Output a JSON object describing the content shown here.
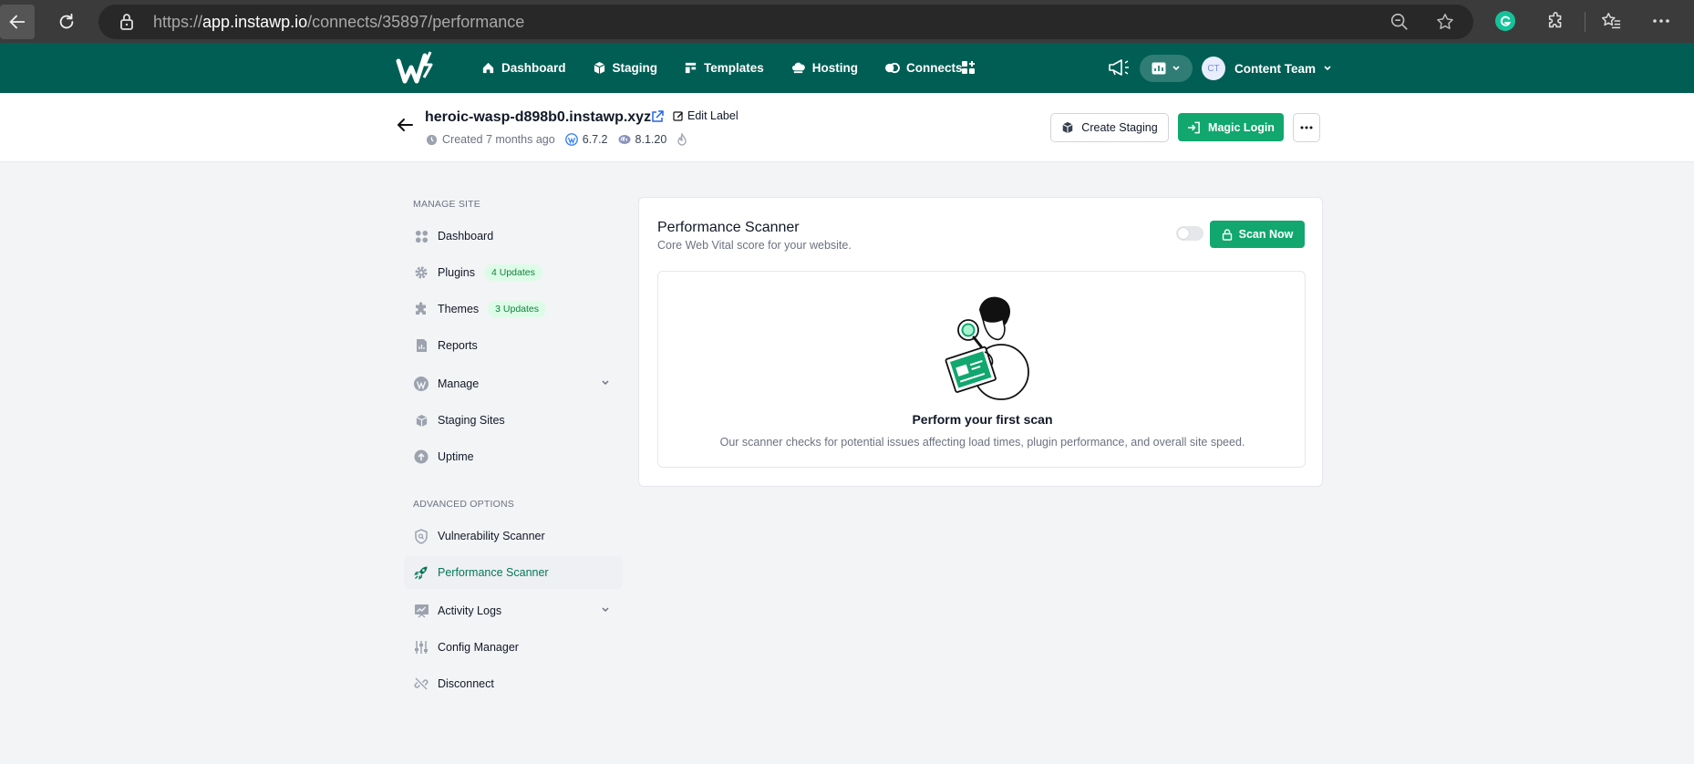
{
  "browser": {
    "url_scheme": "https://",
    "url_host": "app.instawp.io",
    "url_path": "/connects/35897/performance"
  },
  "header": {
    "nav": [
      {
        "label": "Dashboard",
        "icon": "home-icon"
      },
      {
        "label": "Staging",
        "icon": "cube-icon"
      },
      {
        "label": "Templates",
        "icon": "template-icon"
      },
      {
        "label": "Hosting",
        "icon": "cloud-icon"
      },
      {
        "label": "Connects",
        "icon": "connects-icon"
      }
    ],
    "user": {
      "initials": "CT",
      "name": "Content Team"
    },
    "brand_color": "#005e54"
  },
  "site": {
    "name": "heroic-wasp-d898b0.instawp.xyz",
    "edit_label": "Edit Label",
    "created": "Created 7 months ago",
    "wp_version": "6.7.2",
    "php_version": "8.1.20",
    "create_staging": "Create Staging",
    "magic_login": "Magic Login"
  },
  "sidebar": {
    "manage_title": "MANAGE SITE",
    "manage_items": [
      {
        "label": "Dashboard",
        "icon": "grid-icon"
      },
      {
        "label": "Plugins",
        "icon": "gear-icon",
        "badge": "4 Updates"
      },
      {
        "label": "Themes",
        "icon": "puzzle-icon",
        "badge": "3 Updates"
      },
      {
        "label": "Reports",
        "icon": "report-icon"
      },
      {
        "label": "Manage",
        "icon": "wordpress-icon"
      },
      {
        "label": "Staging Sites",
        "icon": "cube-icon"
      },
      {
        "label": "Uptime",
        "icon": "uptime-icon"
      }
    ],
    "advanced_title": "ADVANCED OPTIONS",
    "advanced_items": [
      {
        "label": "Vulnerability Scanner",
        "icon": "shield-icon"
      },
      {
        "label": "Performance Scanner",
        "icon": "rocket-icon"
      },
      {
        "label": "Activity Logs",
        "icon": "activity-icon"
      },
      {
        "label": "Config Manager",
        "icon": "sliders-icon"
      },
      {
        "label": "Disconnect",
        "icon": "unlink-icon"
      }
    ]
  },
  "main": {
    "title": "Performance Scanner",
    "subtitle": "Core Web Vital score for your website.",
    "scan_button": "Scan Now",
    "empty_title": "Perform your first scan",
    "empty_desc": "Our scanner checks for potential issues affecting load times, plugin performance, and overall site speed.",
    "accent": "#11a76e"
  }
}
